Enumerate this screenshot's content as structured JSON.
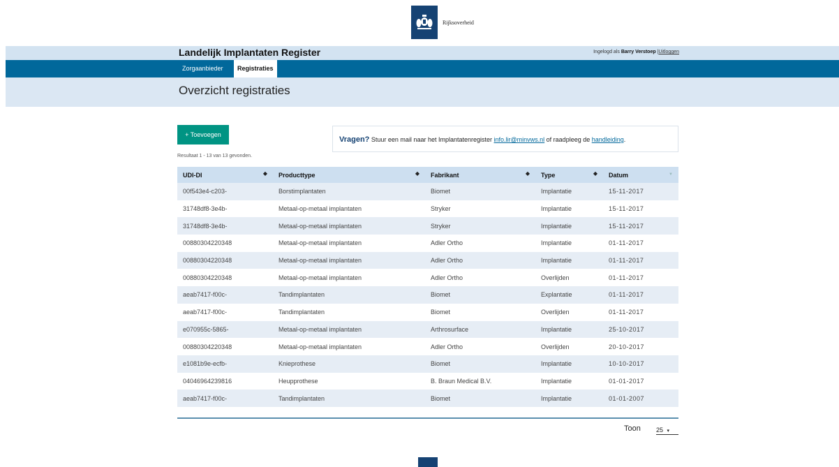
{
  "header": {
    "logo_text": "Rijksoverheid",
    "app_title": "Landelijk Implantaten Register",
    "login_prefix": "Ingelogd als",
    "user_name": "Barry Verstoep",
    "separator": "|",
    "logout_label": "Uitloggen"
  },
  "nav": {
    "tabs": [
      {
        "label": "Zorgaanbieder"
      },
      {
        "label": "Registraties"
      }
    ]
  },
  "page": {
    "title": "Overzicht registraties",
    "add_button": "+ Toevoegen",
    "result_text": "Resultaat 1 - 13 van 13 gevonden."
  },
  "info": {
    "question": "Vragen?",
    "text1": " Stuur een mail naar het Implantatenregister ",
    "email": "info.lir@minvws.nl",
    "text2": " of raadpleeg de ",
    "manual": "handleiding",
    "text3": "."
  },
  "table": {
    "headers": [
      "UDI-DI",
      "Producttype",
      "Fabrikant",
      "Type",
      "Datum"
    ],
    "rows": [
      [
        "00f543e4-c203-",
        "Borstimplantaten",
        "Biomet",
        "Implantatie",
        "15-11-2017"
      ],
      [
        "31748df8-3e4b-",
        "Metaal-op-metaal implantaten",
        "Stryker",
        "Implantatie",
        "15-11-2017"
      ],
      [
        "31748df8-3e4b-",
        "Metaal-op-metaal implantaten",
        "Stryker",
        "Implantatie",
        "15-11-2017"
      ],
      [
        "00880304220348",
        "Metaal-op-metaal implantaten",
        "Adler Ortho",
        "Implantatie",
        "01-11-2017"
      ],
      [
        "00880304220348",
        "Metaal-op-metaal implantaten",
        "Adler Ortho",
        "Implantatie",
        "01-11-2017"
      ],
      [
        "00880304220348",
        "Metaal-op-metaal implantaten",
        "Adler Ortho",
        "Overlijden",
        "01-11-2017"
      ],
      [
        "aeab7417-f00c-",
        "Tandimplantaten",
        "Biomet",
        "Explantatie",
        "01-11-2017"
      ],
      [
        "aeab7417-f00c-",
        "Tandimplantaten",
        "Biomet",
        "Overlijden",
        "01-11-2017"
      ],
      [
        "e070955c-5865-",
        "Metaal-op-metaal implantaten",
        "Arthrosurface",
        "Implantatie",
        "25-10-2017"
      ],
      [
        "00880304220348",
        "Metaal-op-metaal implantaten",
        "Adler Ortho",
        "Overlijden",
        "20-10-2017"
      ],
      [
        "e1081b9e-ecfb-",
        "Knieprothese",
        "Biomet",
        "Implantatie",
        "10-10-2017"
      ],
      [
        "04046964239816",
        "Heupprothese",
        "B. Braun Medical B.V.",
        "Implantatie",
        "01-01-2017"
      ],
      [
        "aeab7417-f00c-",
        "Tandimplantaten",
        "Biomet",
        "Implantatie",
        "01-01-2007"
      ]
    ]
  },
  "pagination": {
    "show_label": "Toon",
    "page_size": "25",
    "caret": "▾"
  },
  "colors": {
    "nav": "#01689b",
    "accent_button": "#009483",
    "header_band": "#d3e3f1",
    "logo": "#154273"
  }
}
